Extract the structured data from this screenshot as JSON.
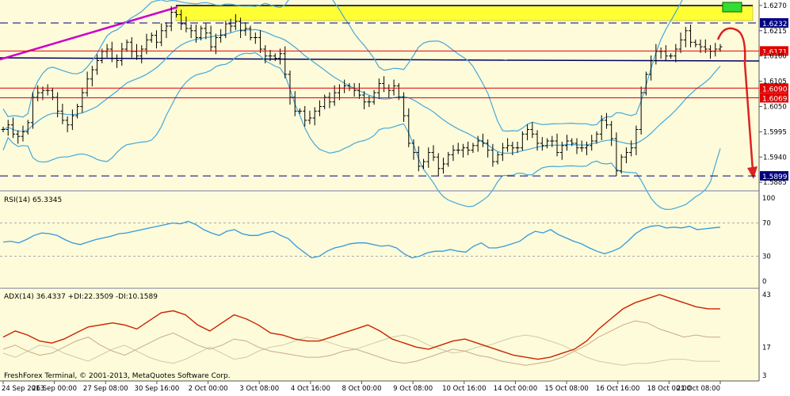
{
  "chart_data": [
    {
      "type": "line",
      "subtype": "ohlc-bars",
      "title": "",
      "y_ticks": [
        "1.6270",
        "1.6215",
        "1.6160",
        "1.6105",
        "1.6050",
        "1.5995",
        "1.5940",
        "1.5885"
      ],
      "ylim": [
        1.5875,
        1.6275
      ],
      "price_levels": [
        {
          "label": "1.6232",
          "value": 1.6232,
          "style": "dashed",
          "color": "#000080"
        },
        {
          "label": "1.6171",
          "value": 1.6171,
          "style": "solid",
          "color": "#e00000"
        },
        {
          "label": "1.6090",
          "value": 1.609,
          "style": "solid",
          "color": "#e00000"
        },
        {
          "label": "1.6069",
          "value": 1.6069,
          "style": "solid",
          "color": "#e00000"
        },
        {
          "label": "1.5899",
          "value": 1.5899,
          "style": "dashed",
          "color": "#000080"
        }
      ],
      "support_line": 1.615,
      "resistance_zone": [
        1.6232,
        1.6265
      ],
      "trendline": {
        "from": [
          0,
          1.616
        ],
        "to": [
          34,
          1.6263
        ],
        "color": "#cc00cc"
      },
      "closes": [
        1.6,
        1.601,
        1.599,
        1.5985,
        1.5995,
        1.6015,
        1.607,
        1.608,
        1.6085,
        1.6085,
        1.607,
        1.604,
        1.602,
        1.601,
        1.603,
        1.605,
        1.608,
        1.611,
        1.613,
        1.615,
        1.617,
        1.6175,
        1.6155,
        1.615,
        1.6175,
        1.619,
        1.617,
        1.616,
        1.6175,
        1.6195,
        1.6205,
        1.619,
        1.6215,
        1.6225,
        1.6255,
        1.625,
        1.623,
        1.622,
        1.6215,
        1.62,
        1.622,
        1.621,
        1.618,
        1.62,
        1.6205,
        1.623,
        1.6225,
        1.6235,
        1.6215,
        1.622,
        1.62,
        1.62,
        1.6175,
        1.616,
        1.616,
        1.6155,
        1.6165,
        1.612,
        1.607,
        1.604,
        1.604,
        1.602,
        1.6025,
        1.604,
        1.605,
        1.607,
        1.606,
        1.608,
        1.609,
        1.6095,
        1.609,
        1.6085,
        1.6075,
        1.606,
        1.606,
        1.608,
        1.61,
        1.609,
        1.6085,
        1.6095,
        1.607,
        1.603,
        1.597,
        1.595,
        1.592,
        1.593,
        1.595,
        1.594,
        1.5915,
        1.5925,
        1.5945,
        1.5955,
        1.5955,
        1.596,
        1.5955,
        1.5965,
        1.5975,
        1.597,
        1.5955,
        1.593,
        1.5945,
        1.596,
        1.5965,
        1.596,
        1.596,
        1.599,
        1.6,
        1.599,
        1.597,
        1.5965,
        1.5975,
        1.5975,
        1.595,
        1.5965,
        1.5975,
        1.597,
        1.596,
        1.596,
        1.5965,
        1.5975,
        1.599,
        1.602,
        1.601,
        1.598,
        1.591,
        1.594,
        1.595,
        1.596,
        1.6,
        1.608,
        1.612,
        1.615,
        1.617,
        1.617,
        1.616,
        1.616,
        1.6175,
        1.6195,
        1.6215,
        1.619,
        1.6185,
        1.618,
        1.6175,
        1.617,
        1.6175,
        1.618
      ],
      "annotations": [
        {
          "type": "arrow",
          "direction": "down",
          "color": "#e00000",
          "from": 1.619,
          "to": 1.5899
        },
        {
          "type": "box",
          "color": "#33cc33"
        }
      ],
      "x_ticks": [
        "24 Sep 2013",
        "26 Sep 00:00",
        "27 Sep 08:00",
        "30 Sep 16:00",
        "2 Oct 00:00",
        "3 Oct 08:00",
        "4 Oct 16:00",
        "8 Oct 00:00",
        "9 Oct 08:00",
        "10 Oct 16:00",
        "14 Oct 00:00",
        "15 Oct 08:00",
        "16 Oct 16:00",
        "18 Oct 00:00",
        "21 Oct 08:00"
      ]
    },
    {
      "type": "line",
      "title": "RSI(14) 65.3345",
      "ylim": [
        0,
        100
      ],
      "y_ticks": [
        "100",
        "70",
        "30",
        "0"
      ],
      "levels": [
        70,
        30
      ],
      "series": [
        {
          "name": "RSI(14)",
          "color": "#3399dd",
          "values": [
            47,
            48,
            46,
            50,
            55,
            58,
            57,
            55,
            50,
            46,
            44,
            47,
            50,
            52,
            54,
            57,
            58,
            60,
            62,
            64,
            66,
            68,
            70,
            69,
            72,
            68,
            62,
            58,
            55,
            60,
            62,
            57,
            55,
            55,
            58,
            60,
            55,
            51,
            42,
            35,
            28,
            30,
            36,
            40,
            42,
            45,
            46,
            46,
            44,
            42,
            43,
            40,
            33,
            28,
            30,
            34,
            36,
            36,
            38,
            36,
            35,
            42,
            46,
            40,
            40,
            42,
            45,
            48,
            55,
            60,
            58,
            62,
            56,
            52,
            48,
            45,
            40,
            36,
            33,
            36,
            40,
            48,
            57,
            63,
            66,
            67,
            64,
            65,
            64,
            66,
            62,
            63,
            64,
            65
          ]
        }
      ]
    },
    {
      "type": "line",
      "title": "ADX(14) 36.4337 +DI:22.3509 -DI:10.1589",
      "ylim": [
        3,
        43
      ],
      "y_ticks": [
        "43",
        "17",
        "3"
      ],
      "series": [
        {
          "name": "ADX(14)",
          "color": "#cc2200",
          "values": [
            22,
            25,
            23,
            20,
            19,
            21,
            24,
            27,
            28,
            29,
            28,
            26,
            30,
            34,
            35,
            33,
            28,
            25,
            29,
            33,
            31,
            28,
            24,
            23,
            21,
            20,
            20,
            22,
            24,
            26,
            28,
            25,
            21,
            19,
            17,
            16,
            18,
            20,
            21,
            19,
            17,
            15,
            13,
            12,
            11,
            12,
            14,
            16,
            20,
            26,
            31,
            36,
            39,
            41,
            43,
            41,
            39,
            37,
            36,
            36
          ]
        },
        {
          "name": "+DI",
          "color": "#ccaa88",
          "values": [
            16,
            18,
            15,
            13,
            14,
            17,
            20,
            22,
            18,
            15,
            13,
            16,
            19,
            22,
            24,
            21,
            18,
            16,
            18,
            21,
            20,
            17,
            15,
            14,
            13,
            12,
            12,
            13,
            15,
            16,
            14,
            12,
            10,
            9,
            10,
            12,
            14,
            16,
            15,
            13,
            12,
            10,
            9,
            8,
            9,
            10,
            12,
            15,
            18,
            22,
            25,
            28,
            30,
            29,
            26,
            24,
            22,
            23,
            22,
            22
          ]
        },
        {
          "name": "-DI",
          "color": "#ccccaa",
          "values": [
            14,
            12,
            15,
            18,
            17,
            14,
            12,
            10,
            13,
            16,
            18,
            15,
            12,
            10,
            9,
            11,
            14,
            17,
            14,
            11,
            12,
            15,
            17,
            18,
            20,
            22,
            21,
            19,
            17,
            16,
            18,
            20,
            22,
            23,
            21,
            18,
            16,
            14,
            15,
            17,
            18,
            20,
            22,
            23,
            22,
            20,
            18,
            15,
            12,
            10,
            9,
            8,
            9,
            9,
            10,
            11,
            11,
            10,
            10,
            10
          ]
        }
      ]
    }
  ],
  "footer": {
    "copyright": "FreshForex Terminal, © 2001-2013, MetaQuotes Software Corp."
  }
}
